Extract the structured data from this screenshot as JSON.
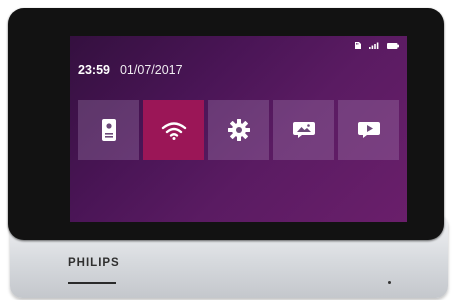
{
  "status_bar": {
    "icons": [
      "sd-card-icon",
      "signal-icon",
      "battery-icon"
    ]
  },
  "clock": {
    "time": "23:59",
    "date": "01/07/2017"
  },
  "tiles": [
    {
      "icon": "door-station-icon",
      "active": false
    },
    {
      "icon": "wifi-icon",
      "active": true
    },
    {
      "icon": "settings-icon",
      "active": false
    },
    {
      "icon": "photo-icon",
      "active": false
    },
    {
      "icon": "video-icon",
      "active": false
    }
  ],
  "colors": {
    "screen_start": "#34103f",
    "screen_end": "#6a1f6b",
    "tile": "#7b5a86",
    "active_tile": "#9b1657"
  },
  "device": {
    "brand": "PHILIPS"
  }
}
